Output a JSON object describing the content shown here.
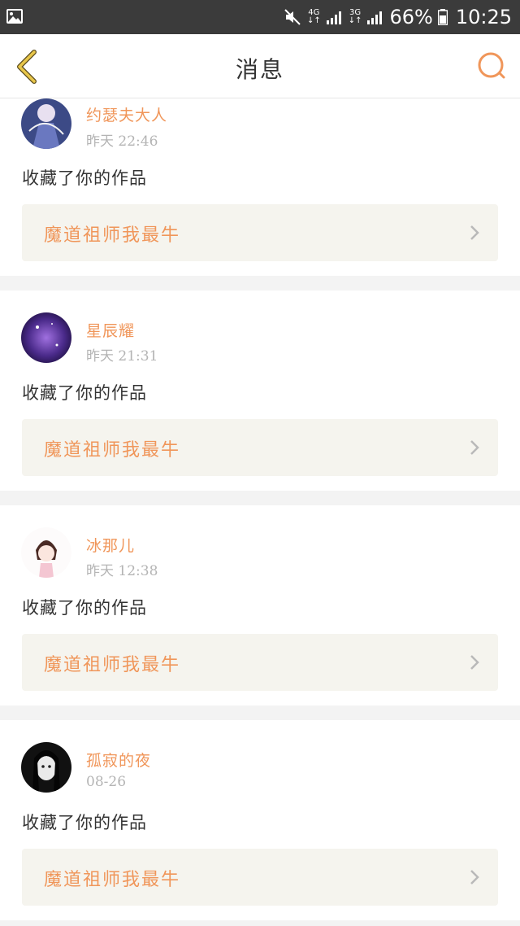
{
  "status_bar": {
    "network_4g": "4G",
    "network_3g": "3G",
    "battery": "66%",
    "time": "10:25",
    "icons": [
      "image-icon",
      "mute-icon",
      "signal-icon",
      "battery-icon"
    ]
  },
  "navbar": {
    "title": "消息",
    "back_icon": "chevron-left-icon",
    "search_icon": "search-icon",
    "accent": "#f0965a"
  },
  "messages": [
    {
      "user": "约瑟夫大人",
      "time": "昨天 22:46",
      "action": "收藏了你的作品",
      "work": "魔道祖师我最牛"
    },
    {
      "user": "星辰耀",
      "time": "昨天 21:31",
      "action": "收藏了你的作品",
      "work": "魔道祖师我最牛"
    },
    {
      "user": "冰那儿",
      "time": "昨天 12:38",
      "action": "收藏了你的作品",
      "work": "魔道祖师我最牛"
    },
    {
      "user": "孤寂的夜",
      "time": "08-26",
      "action": "收藏了你的作品",
      "work": "魔道祖师我最牛"
    }
  ],
  "colors": {
    "username": "#f0965a",
    "work_title": "#f0965a",
    "work_bg": "#f5f4ee",
    "divider": "#f3f3f3"
  }
}
